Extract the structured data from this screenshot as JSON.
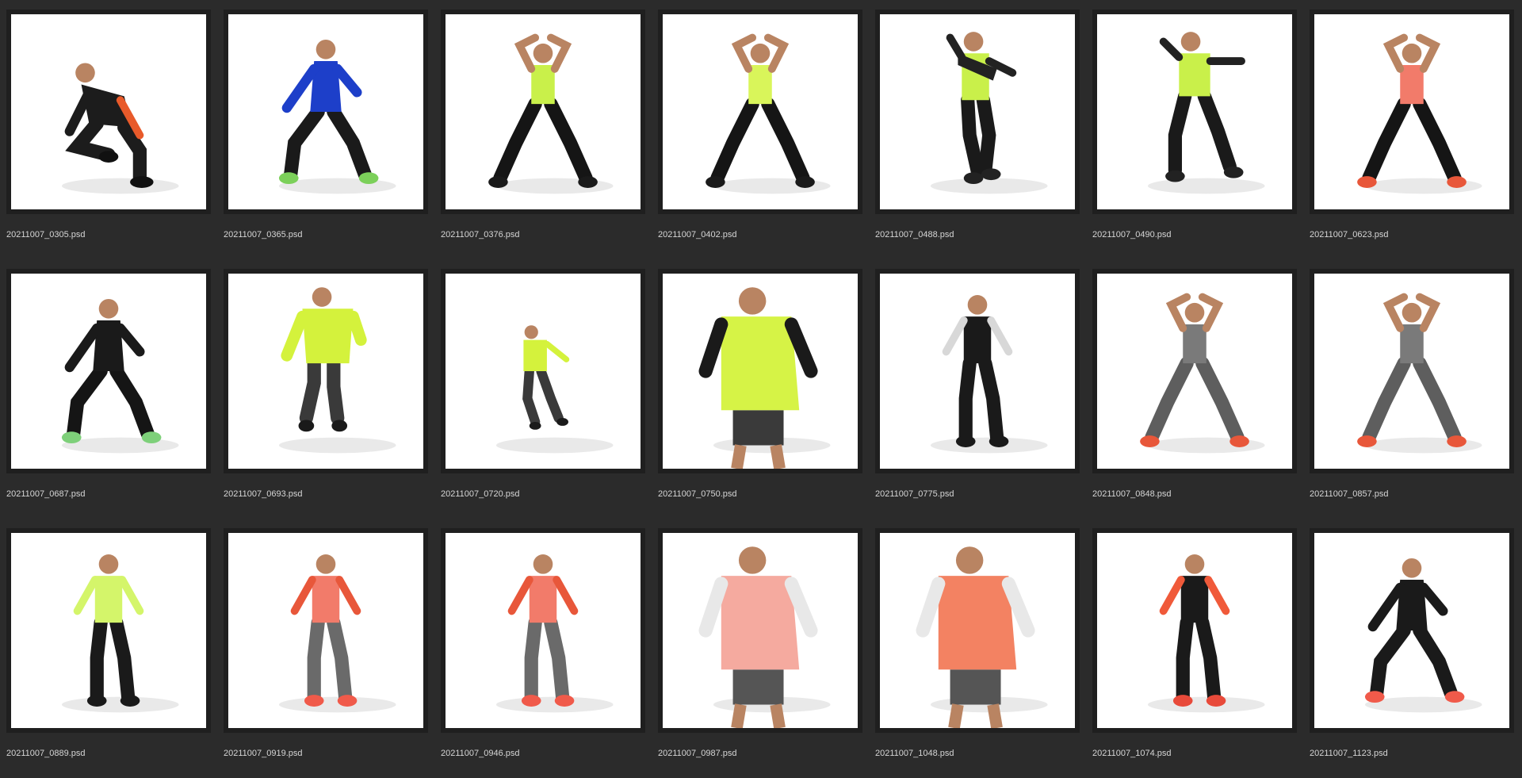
{
  "files": [
    {
      "name": "20211007_0305.psd",
      "pose": "crouch",
      "top": "#1c1c1c",
      "bottom": "#1c1c1c",
      "accent": "#e85a2a",
      "shoe": "#111111"
    },
    {
      "name": "20211007_0365.psd",
      "pose": "lunge",
      "top": "#1d3fc9",
      "bottom": "#1a1a1a",
      "accent": "#c05030",
      "shoe": "#7cd05a"
    },
    {
      "name": "20211007_0376.psd",
      "pose": "wide",
      "top": "#c9f04a",
      "bottom": "#151515",
      "accent": "#c9f04a",
      "shoe": "#1a1a1a"
    },
    {
      "name": "20211007_0402.psd",
      "pose": "wide",
      "top": "#d9f55a",
      "bottom": "#151515",
      "accent": "#d9f55a",
      "shoe": "#1a1a1a"
    },
    {
      "name": "20211007_0488.psd",
      "pose": "walk",
      "top": "#c9f04a",
      "bottom": "#1a1a1a",
      "accent": "#222222",
      "shoe": "#222222"
    },
    {
      "name": "20211007_0490.psd",
      "pose": "dance",
      "top": "#c9f04a",
      "bottom": "#1a1a1a",
      "accent": "#222222",
      "shoe": "#222222"
    },
    {
      "name": "20211007_0623.psd",
      "pose": "wide",
      "top": "#f27b6a",
      "bottom": "#151515",
      "accent": "#f27b6a",
      "shoe": "#e8573a"
    },
    {
      "name": "20211007_0687.psd",
      "pose": "lunge",
      "top": "#1a1a1a",
      "bottom": "#151515",
      "accent": "#333333",
      "shoe": "#7ed07a"
    },
    {
      "name": "20211007_0693.psd",
      "pose": "jump",
      "top": "#d4f23c",
      "bottom": "#3a3a3a",
      "accent": "#d4f23c",
      "shoe": "#1a1a1a"
    },
    {
      "name": "20211007_0720.psd",
      "pose": "walk-small",
      "top": "#d4f23c",
      "bottom": "#3a3a3a",
      "accent": "#d4f23c",
      "shoe": "#1a1a1a"
    },
    {
      "name": "20211007_0750.psd",
      "pose": "close",
      "top": "#d4f23c",
      "bottom": "#3a3a3a",
      "accent": "#1a1a1a",
      "shoe": "#1a1a1a"
    },
    {
      "name": "20211007_0775.psd",
      "pose": "stand",
      "top": "#1a1a1a",
      "bottom": "#1a1a1a",
      "accent": "#d8d8d8",
      "shoe": "#1a1a1a"
    },
    {
      "name": "20211007_0848.psd",
      "pose": "wide",
      "top": "#7a7a7a",
      "bottom": "#5e5e5e",
      "accent": "#c9f04a",
      "shoe": "#e8573a"
    },
    {
      "name": "20211007_0857.psd",
      "pose": "wide",
      "top": "#7a7a7a",
      "bottom": "#5e5e5e",
      "accent": "#c9f04a",
      "shoe": "#e8573a"
    },
    {
      "name": "20211007_0889.psd",
      "pose": "stand",
      "top": "#d4f56a",
      "bottom": "#1a1a1a",
      "accent": "#d4f56a",
      "shoe": "#1a1a1a"
    },
    {
      "name": "20211007_0919.psd",
      "pose": "stand",
      "top": "#f27b6a",
      "bottom": "#6a6a6a",
      "accent": "#e8573a",
      "shoe": "#f05a4a"
    },
    {
      "name": "20211007_0946.psd",
      "pose": "stand",
      "top": "#f27b6a",
      "bottom": "#6a6a6a",
      "accent": "#e8573a",
      "shoe": "#f05a4a"
    },
    {
      "name": "20211007_0987.psd",
      "pose": "close",
      "top": "#f4a59a",
      "bottom": "#555555",
      "accent": "#e8e8e8",
      "shoe": "#f05a4a"
    },
    {
      "name": "20211007_1048.psd",
      "pose": "close",
      "top": "#f27b5a",
      "bottom": "#555555",
      "accent": "#e8e8e8",
      "shoe": "#f05a4a"
    },
    {
      "name": "20211007_1074.psd",
      "pose": "stand",
      "top": "#1a1a1a",
      "bottom": "#1a1a1a",
      "accent": "#f05a3a",
      "shoe": "#e84a3a"
    },
    {
      "name": "20211007_1123.psd",
      "pose": "lunge",
      "top": "#1a1a1a",
      "bottom": "#1a1a1a",
      "accent": "#f27b6a",
      "shoe": "#f05a4a"
    }
  ],
  "colors": {
    "background": "#2b2b2b",
    "frame": "#1f1f1f",
    "thumbnail_bg": "#ffffff",
    "filename_text": "#d6d6d6",
    "skin": "#b98462"
  }
}
